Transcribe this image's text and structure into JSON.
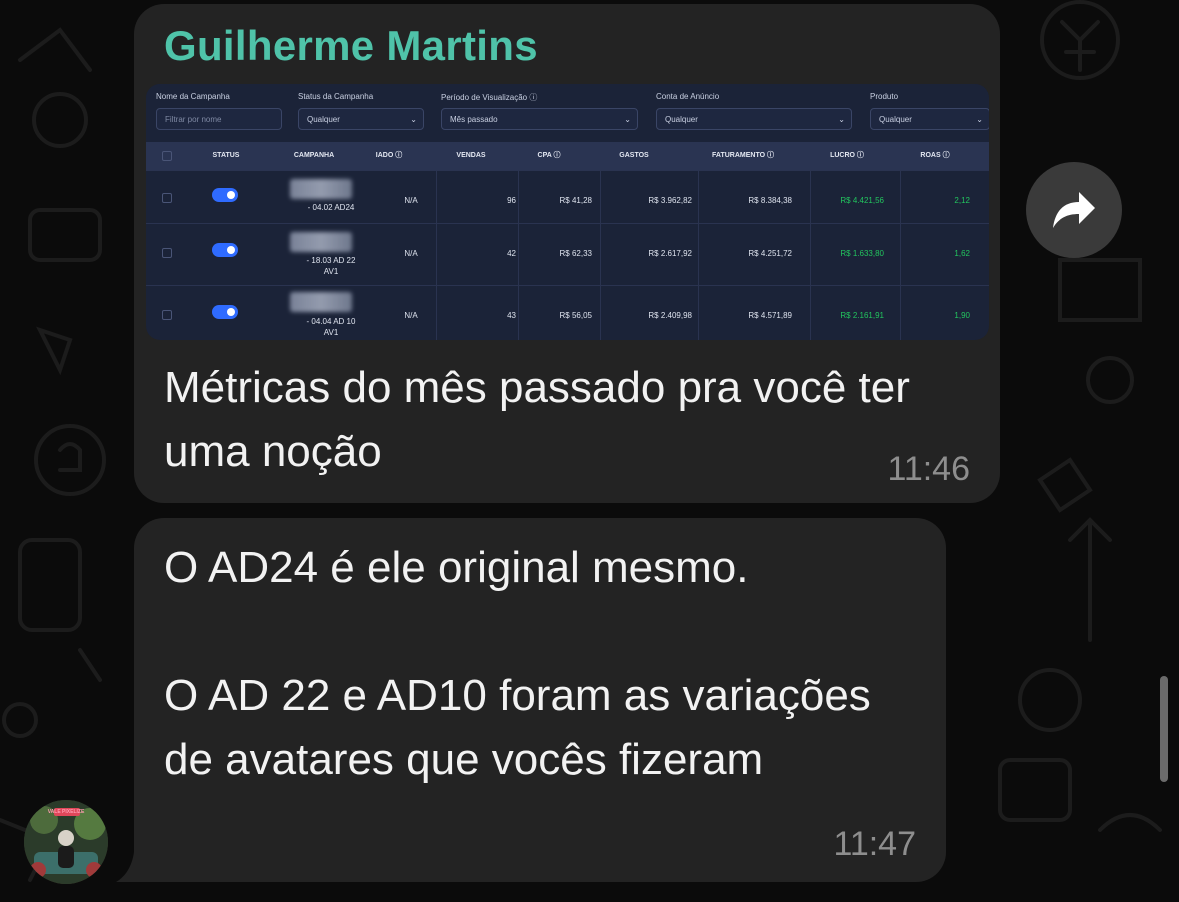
{
  "message1": {
    "sender": "Guilherme Martins",
    "text": "Métricas do mês passado pra você ter uma noção",
    "time": "11:46"
  },
  "message2": {
    "line1": "O AD24 é ele original mesmo.",
    "line2": "O AD 22 e AD10 foram as variações de avatares que vocês fizeram",
    "time": "11:47"
  },
  "avatar": {
    "caption": "VALE PIXELIZE"
  },
  "dashboard": {
    "filters": [
      {
        "label": "Nome da Campanha",
        "value": "Filtrar por nome"
      },
      {
        "label": "Status da Campanha",
        "value": "Qualquer"
      },
      {
        "label": "Período de Visualização ⓘ",
        "value": "Mês passado"
      },
      {
        "label": "Conta de Anúncio",
        "value": "Qualquer"
      },
      {
        "label": "Produto",
        "value": "Qualquer"
      }
    ],
    "columns": {
      "status": "STATUS",
      "campanha": "CAMPANHA",
      "ado": "IADO ⓘ",
      "vendas": "VENDAS",
      "cpa": "CPA ⓘ",
      "gastos": "GASTOS",
      "faturamento": "FATURAMENTO ⓘ",
      "lucro": "LUCRO ⓘ",
      "roas": "ROAS ⓘ"
    },
    "rows": [
      {
        "campaign_l1": "- 04.02 AD24",
        "campaign_l2": "",
        "ado": "N/A",
        "vendas": "96",
        "cpa": "R$ 41,28",
        "gastos": "R$ 3.962,82",
        "faturamento": "R$ 8.384,38",
        "lucro": "R$ 4.421,56",
        "roas": "2,12"
      },
      {
        "campaign_l1": "- 18.03 AD 22",
        "campaign_l2": "AV1",
        "ado": "N/A",
        "vendas": "42",
        "cpa": "R$ 62,33",
        "gastos": "R$ 2.617,92",
        "faturamento": "R$ 4.251,72",
        "lucro": "R$ 1.633,80",
        "roas": "1,62"
      },
      {
        "campaign_l1": "- 04.04 AD 10",
        "campaign_l2": "AV1",
        "ado": "N/A",
        "vendas": "43",
        "cpa": "R$ 56,05",
        "gastos": "R$ 2.409,98",
        "faturamento": "R$ 4.571,89",
        "lucro": "R$ 2.161,91",
        "roas": "1,90"
      }
    ]
  },
  "colors": {
    "sender": "#4fc3a9",
    "bubble": "#232323",
    "background": "#0b0b0b",
    "profit_green": "#22c55e",
    "toggle_blue": "#2f6bff"
  }
}
